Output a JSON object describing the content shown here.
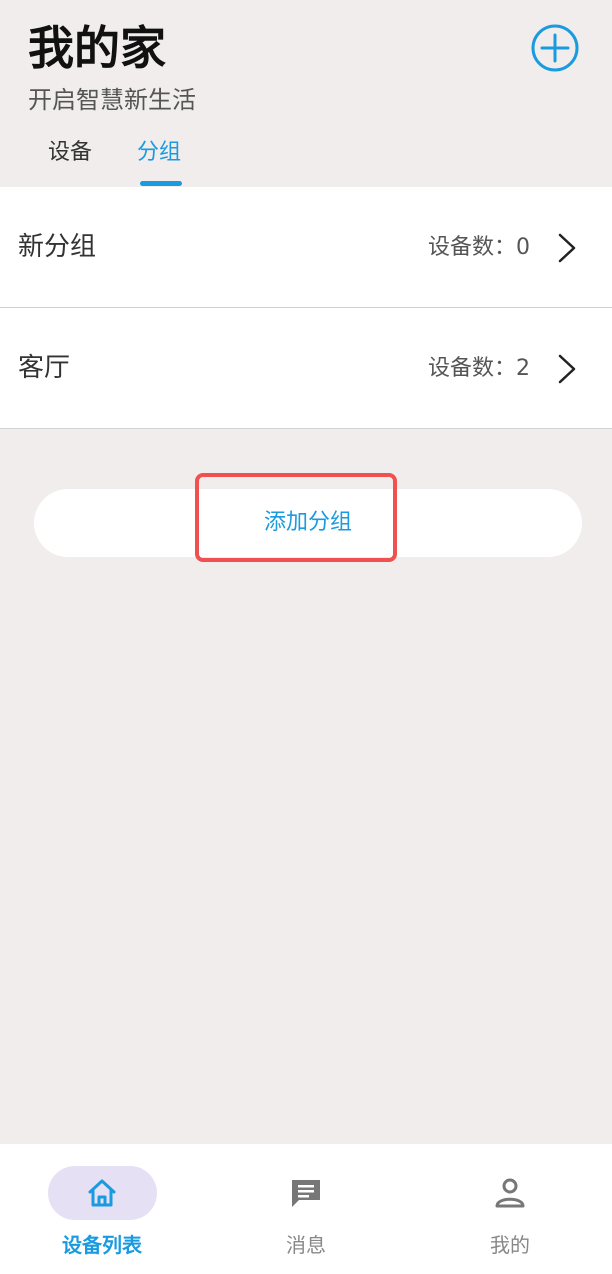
{
  "header": {
    "title": "我的家",
    "subtitle": "开启智慧新生活",
    "add_icon": "plus-circle-icon"
  },
  "tabs": [
    {
      "label": "设备",
      "active": false
    },
    {
      "label": "分组",
      "active": true
    }
  ],
  "groups": [
    {
      "name": "新分组",
      "count_label": "设备数：0"
    },
    {
      "name": "客厅",
      "count_label": "设备数：2"
    }
  ],
  "add_group": {
    "label": "添加分组"
  },
  "bottom_nav": [
    {
      "label": "设备列表",
      "icon": "home-icon",
      "active": true
    },
    {
      "label": "消息",
      "icon": "message-icon",
      "active": false
    },
    {
      "label": "我的",
      "icon": "person-icon",
      "active": false
    }
  ],
  "colors": {
    "accent": "#1a9be0",
    "background": "#f1eded",
    "highlight": "#f05050",
    "active_pill": "#e6e0f5"
  }
}
